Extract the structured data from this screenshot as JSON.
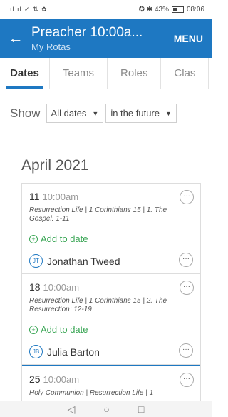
{
  "status_bar": {
    "left": "ıl ıl ✓ ⇅ ✿",
    "battery_text": "✪ ✱ 43%",
    "time": "08:06"
  },
  "app_bar": {
    "title": "Preacher 10:00a...",
    "subtitle": "My Rotas",
    "menu_label": "MENU"
  },
  "tabs": [
    "Dates",
    "Teams",
    "Roles",
    "Clas"
  ],
  "filters": {
    "show_label": "Show",
    "select1": "All dates",
    "select2": "in the future"
  },
  "month": "April 2021",
  "items": [
    {
      "day": "11",
      "time": "10:00am",
      "description": "Resurrection Life | 1 Corinthians 15 | 1. The Gospel: 1-11",
      "add_label": "Add to date",
      "initials": "JT",
      "person": "Jonathan Tweed"
    },
    {
      "day": "18",
      "time": "10:00am",
      "description": "Resurrection Life | 1 Corinthians 15 | 2. The Resurrection: 12-19",
      "add_label": "Add to date",
      "initials": "JB",
      "person": "Julia Barton"
    },
    {
      "day": "25",
      "time": "10:00am",
      "description": "Holy Communion | Resurrection Life | 1"
    }
  ],
  "nav": {
    "back": "◁",
    "home": "○",
    "recents": "□"
  },
  "icons": {
    "back": "arrow-left-icon",
    "more": "more-horizontal-icon",
    "add": "plus-circle-icon"
  },
  "colors": {
    "primary": "#1e78c2",
    "add_green": "#3aa655"
  }
}
